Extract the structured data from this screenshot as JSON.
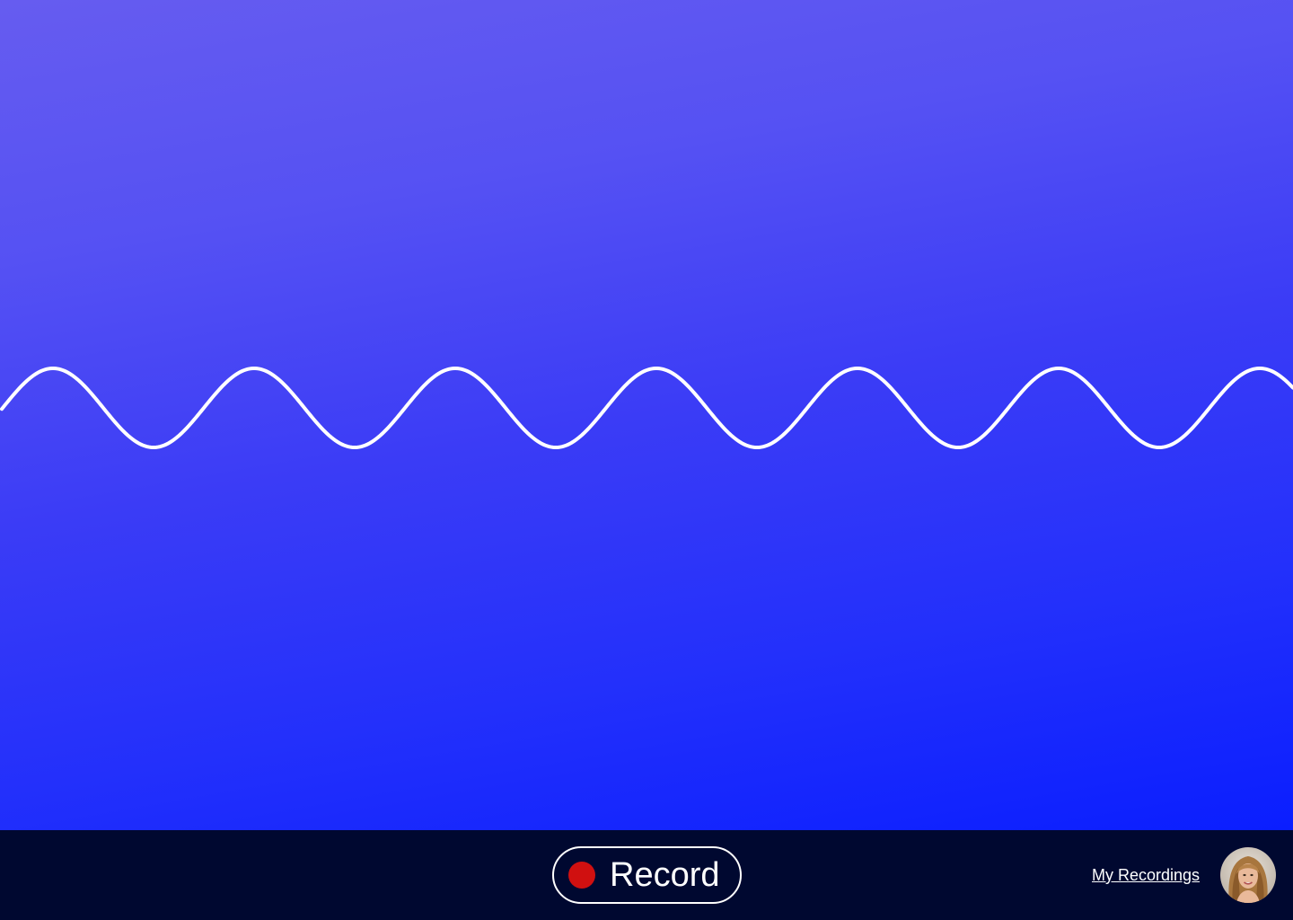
{
  "theme": {
    "gradient_top": "#665cf0",
    "gradient_bottom": "#0a1eff",
    "bar_background": "#000830",
    "record_dot_color": "#d01010",
    "wave_color": "#ffffff"
  },
  "waveform": {
    "icon": "sine-wave"
  },
  "bottom_bar": {
    "record_button": {
      "label": "Record",
      "icon": "record-dot-icon"
    },
    "my_recordings_link": "My Recordings",
    "avatar": {
      "icon": "user-avatar"
    }
  }
}
